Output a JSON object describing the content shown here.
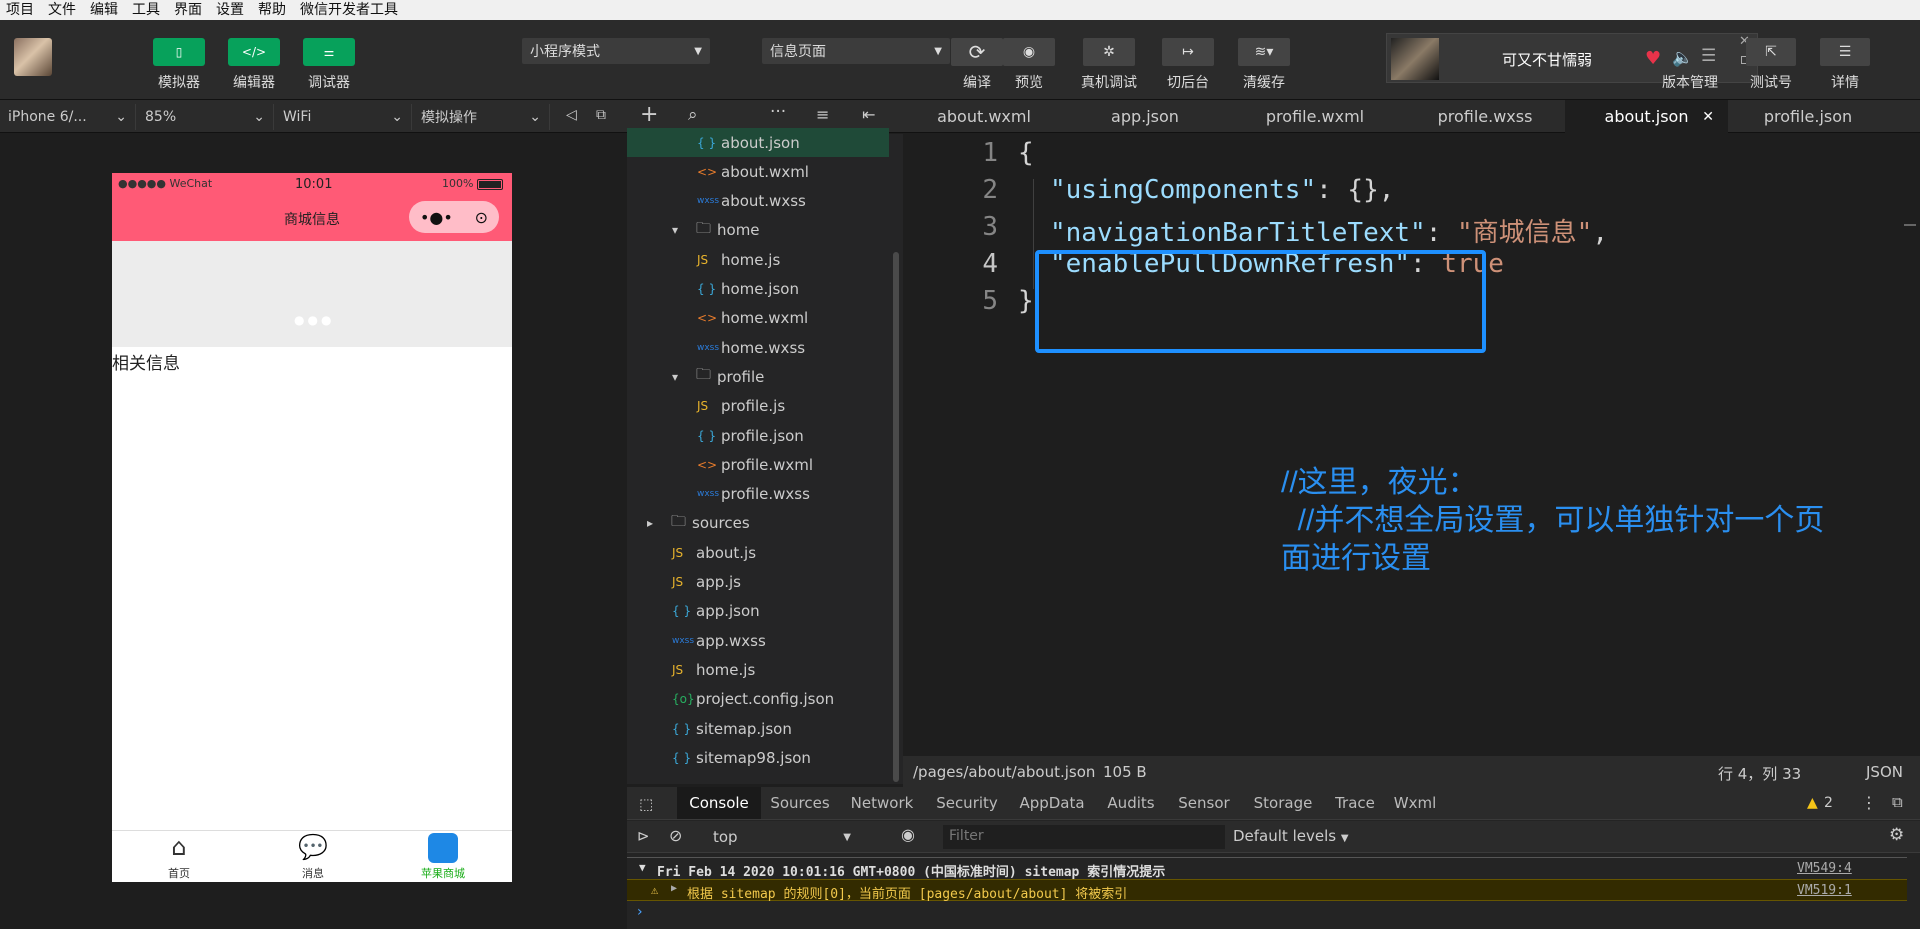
{
  "menubar": [
    "项目",
    "文件",
    "编辑",
    "工具",
    "界面",
    "设置",
    "帮助",
    "微信开发者工具"
  ],
  "toolbar": {
    "simulator": "模拟器",
    "editor": "编辑器",
    "debugger": "调试器",
    "mode": "小程序模式",
    "page": "信息页面",
    "compile": "编译",
    "preview": "预览",
    "real_debug": "真机调试",
    "background": "切后台",
    "clear_cache": "清缓存",
    "version": "版本管理",
    "test_id": "测试号",
    "details": "详情"
  },
  "music": {
    "title": "可又不甘懦弱"
  },
  "secondbar": {
    "device": "iPhone 6/...",
    "zoom": "85%",
    "network": "WiFi",
    "sim_ops": "模拟操作"
  },
  "tabs": [
    "about.wxml",
    "app.json",
    "profile.wxml",
    "profile.wxss",
    "about.json",
    "profile.json"
  ],
  "phone": {
    "carrier": "●●●●● WeChat",
    "time": "10:01",
    "battery": "100%",
    "nav_title": "商城信息",
    "body_text": "相关信息",
    "tabbar": [
      "首页",
      "消息",
      "苹果商城"
    ]
  },
  "tree": [
    {
      "icon": "{ }",
      "name": "about.json",
      "indent": 1,
      "type": "json",
      "selected": true
    },
    {
      "icon": "<>",
      "name": "about.wxml",
      "indent": 1,
      "type": "wxml"
    },
    {
      "icon": "wxss",
      "name": "about.wxss",
      "indent": 1,
      "type": "wxss"
    },
    {
      "icon": "▾",
      "name": "home",
      "indent": 0,
      "type": "folder"
    },
    {
      "icon": "JS",
      "name": "home.js",
      "indent": 1,
      "type": "js"
    },
    {
      "icon": "{ }",
      "name": "home.json",
      "indent": 1,
      "type": "json"
    },
    {
      "icon": "<>",
      "name": "home.wxml",
      "indent": 1,
      "type": "wxml"
    },
    {
      "icon": "wxss",
      "name": "home.wxss",
      "indent": 1,
      "type": "wxss"
    },
    {
      "icon": "▾",
      "name": "profile",
      "indent": 0,
      "type": "folder"
    },
    {
      "icon": "JS",
      "name": "profile.js",
      "indent": 1,
      "type": "js"
    },
    {
      "icon": "{ }",
      "name": "profile.json",
      "indent": 1,
      "type": "json"
    },
    {
      "icon": "<>",
      "name": "profile.wxml",
      "indent": 1,
      "type": "wxml"
    },
    {
      "icon": "wxss",
      "name": "profile.wxss",
      "indent": 1,
      "type": "wxss"
    },
    {
      "icon": "▸",
      "name": "sources",
      "indent": -1,
      "type": "folder"
    },
    {
      "icon": "JS",
      "name": "about.js",
      "indent": 0,
      "type": "js"
    },
    {
      "icon": "JS",
      "name": "app.js",
      "indent": 0,
      "type": "js"
    },
    {
      "icon": "{ }",
      "name": "app.json",
      "indent": 0,
      "type": "json"
    },
    {
      "icon": "wxss",
      "name": "app.wxss",
      "indent": 0,
      "type": "wxss"
    },
    {
      "icon": "JS",
      "name": "home.js",
      "indent": 0,
      "type": "js"
    },
    {
      "icon": "{o}",
      "name": "project.config.json",
      "indent": 0,
      "type": "config"
    },
    {
      "icon": "{ }",
      "name": "sitemap.json",
      "indent": 0,
      "type": "json"
    },
    {
      "icon": "{ }",
      "name": "sitemap98.json",
      "indent": 0,
      "type": "json"
    }
  ],
  "code": {
    "line_numbers": [
      "1",
      "2",
      "3",
      "4",
      "5"
    ],
    "brace_open": "{",
    "k1": "\"usingComponents\"",
    "v1": ": {},",
    "k2": "\"navigationBarTitleText\"",
    "v2_sep": ": ",
    "v2": "\"商城信息\"",
    "v2_end": ",",
    "k3": "\"enablePullDownRefresh\"",
    "v3_sep": ": ",
    "v3": "true",
    "brace_close": "}"
  },
  "annotation": {
    "line1": "//这里，夜光：",
    "line2": "  //并不想全局设置，可以单独针对一个页",
    "line3": "面进行设置"
  },
  "status": {
    "path": "/pages/about/about.json",
    "size": "105 B",
    "position": "行 4，列 33",
    "lang": "JSON"
  },
  "devtools": {
    "tabs": [
      "Console",
      "Sources",
      "Network",
      "Security",
      "AppData",
      "Audits",
      "Sensor",
      "Storage",
      "Trace",
      "Wxml"
    ],
    "warn_count": "2",
    "context": "top",
    "filter_placeholder": "Filter",
    "levels": "Default levels",
    "log1": "Fri Feb 14 2020 10:01:16 GMT+0800 (中国标准时间) sitemap 索引情况提示",
    "log1_src": "VM549:4",
    "log2": "根据 sitemap 的规则[0]，当前页面 [pages/about/about] 将被索引",
    "log2_src": "VM519:1"
  },
  "colors": {
    "green": "#07a15b",
    "nav_pink": "#ff5a76",
    "highlight_box": "#1e90ff",
    "annotation": "#2a8ff0",
    "key": "#9cdcfe",
    "string": "#ce9178"
  }
}
